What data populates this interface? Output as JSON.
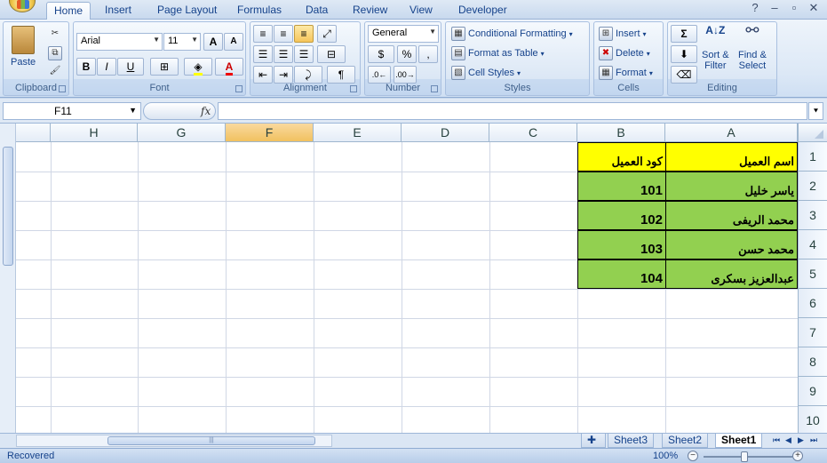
{
  "tabs": [
    "Home",
    "Insert",
    "Page Layout",
    "Formulas",
    "Data",
    "Review",
    "View",
    "Developer"
  ],
  "ribbon": {
    "clipboard": {
      "paste": "Paste",
      "label": "Clipboard"
    },
    "font": {
      "name": "Arial",
      "size": "11",
      "label": "Font",
      "bold": "B",
      "italic": "I",
      "underline": "U",
      "grow": "A",
      "shrink": "A"
    },
    "alignment": {
      "label": "Alignment"
    },
    "number": {
      "format": "General",
      "label": "Number"
    },
    "styles": {
      "conditional": "Conditional Formatting",
      "format_table": "Format as Table",
      "cell_styles": "Cell Styles",
      "label": "Styles"
    },
    "cells": {
      "insert": "Insert",
      "delete": "Delete",
      "format": "Format",
      "label": "Cells"
    },
    "editing": {
      "sort": "Sort &",
      "sort2": "Filter",
      "find": "Find &",
      "find2": "Select",
      "label": "Editing"
    }
  },
  "formula_bar": {
    "name_box": "F11",
    "fx": "fx",
    "formula": ""
  },
  "columns": [
    "H",
    "G",
    "F",
    "E",
    "D",
    "C",
    "B",
    "A"
  ],
  "selected_column": "F",
  "rows": [
    "1",
    "2",
    "3",
    "4",
    "5",
    "6",
    "7",
    "8",
    "9",
    "10"
  ],
  "table": {
    "headers": {
      "name": "اسم العميل",
      "code": "كود العميل"
    },
    "rows": [
      {
        "name": "ياسر خليل",
        "code": "101"
      },
      {
        "name": "محمد الريفى",
        "code": "102"
      },
      {
        "name": "محمد حسن",
        "code": "103"
      },
      {
        "name": "عبدالعزيز بسكرى",
        "code": "104"
      }
    ]
  },
  "sheets": [
    "Sheet3",
    "Sheet2",
    "Sheet1"
  ],
  "active_sheet": "Sheet1",
  "status": {
    "text": "Recovered",
    "zoom": "100%"
  },
  "colors": {
    "header_fill": "#ffff00",
    "data_fill": "#92d050",
    "selected_col": "#f1c15f"
  }
}
